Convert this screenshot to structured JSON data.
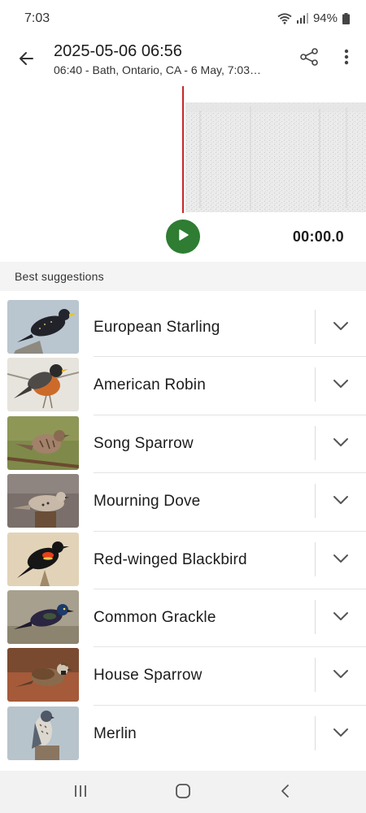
{
  "status_bar": {
    "time": "7:03",
    "battery": "94%"
  },
  "header": {
    "title": "2025-05-06 06:56",
    "subtitle": "06:40 - Bath, Ontario, CA - 6 May, 7:03…"
  },
  "player": {
    "time": "00:00.0"
  },
  "suggestions": {
    "heading": "Best suggestions",
    "items": [
      {
        "name": "European Starling"
      },
      {
        "name": "American Robin"
      },
      {
        "name": "Song Sparrow"
      },
      {
        "name": "Mourning Dove"
      },
      {
        "name": "Red-winged Blackbird"
      },
      {
        "name": "Common Grackle"
      },
      {
        "name": "House Sparrow"
      },
      {
        "name": "Merlin"
      }
    ]
  },
  "colors": {
    "accent_green": "#2e7d32",
    "playhead_red": "#c62828",
    "section_bg": "#f4f4f4"
  },
  "icons": {
    "back": "arrow-left-icon",
    "share": "share-icon",
    "more": "more-vert-icon",
    "play": "play-icon",
    "expand": "chevron-down-icon",
    "nav_recent": "recent-apps-icon",
    "nav_home": "home-icon",
    "nav_back": "nav-back-icon"
  }
}
